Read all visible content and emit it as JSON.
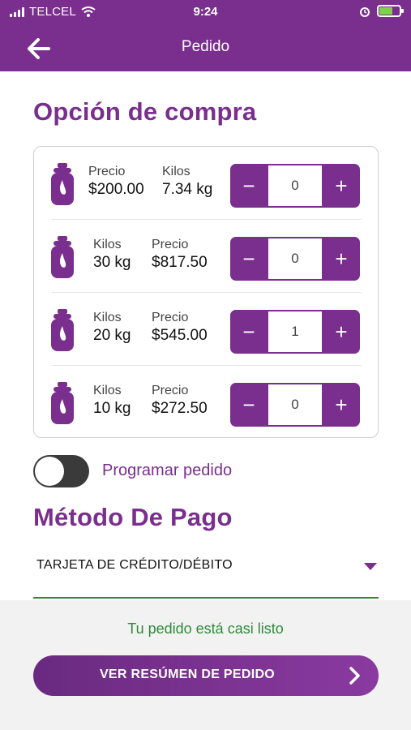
{
  "status_bar": {
    "carrier": "TELCEL",
    "time": "9:24",
    "icons": [
      "signal-icon",
      "wifi-icon",
      "alarm-icon",
      "battery-charging-icon"
    ]
  },
  "nav": {
    "title": "Pedido",
    "back_icon": "arrow-left-icon"
  },
  "purchase": {
    "title": "Opción de compra",
    "items": [
      {
        "icon": "gas-tank-icon",
        "col1_label": "Precio",
        "col1_value": "$200.00",
        "col2_label": "Kilos",
        "col2_value": "7.34 kg",
        "quantity": "0"
      },
      {
        "icon": "gas-tank-icon",
        "col1_label": "Kilos",
        "col1_value": "30 kg",
        "col2_label": "Precio",
        "col2_value": "$817.50",
        "quantity": "0"
      },
      {
        "icon": "gas-tank-icon",
        "col1_label": "Kilos",
        "col1_value": "20 kg",
        "col2_label": "Precio",
        "col2_value": "$545.00",
        "quantity": "1"
      },
      {
        "icon": "gas-tank-icon",
        "col1_label": "Kilos",
        "col1_value": "10 kg",
        "col2_label": "Precio",
        "col2_value": "$272.50",
        "quantity": "0"
      }
    ],
    "minus_label": "−",
    "plus_label": "+"
  },
  "schedule": {
    "label": "Programar pedido",
    "enabled": false
  },
  "payment": {
    "title": "Método De Pago",
    "selected": "TARJETA DE CRÉDITO/DÉBITO"
  },
  "footer": {
    "status_message": "Tu pedido está casi listo",
    "cta_label": "VER RESÚMEN DE PEDIDO"
  },
  "colors": {
    "brand": "#7a2e8e",
    "success": "#2e8b3a"
  }
}
